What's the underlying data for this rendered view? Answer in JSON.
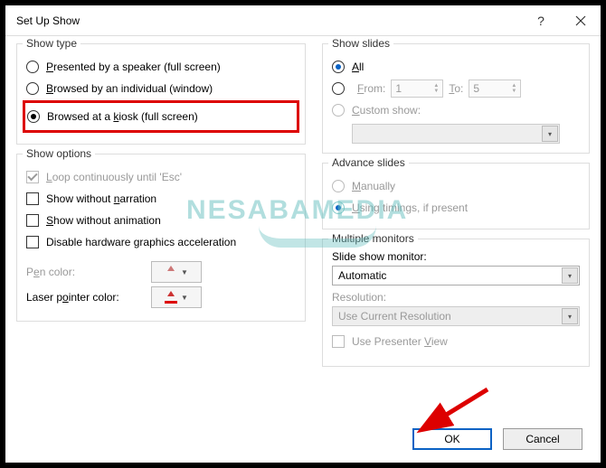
{
  "title": "Set Up Show",
  "groups": {
    "show_type": {
      "title": "Show type",
      "options": {
        "presented": "Presented by a speaker (full screen)",
        "browsed_individual": "Browsed by an individual (window)",
        "browsed_kiosk": "Browsed at a kiosk (full screen)"
      },
      "selected": "browsed_kiosk"
    },
    "show_options": {
      "title": "Show options",
      "loop": "Loop continuously until 'Esc'",
      "no_narration": "Show without narration",
      "no_animation": "Show without animation",
      "disable_hw": "Disable hardware graphics acceleration",
      "pen_color_label": "Pen color:",
      "laser_color_label": "Laser pointer color:"
    },
    "show_slides": {
      "title": "Show slides",
      "all": "All",
      "from": "From:",
      "to": "To:",
      "from_value": "1",
      "to_value": "5",
      "custom": "Custom show:",
      "selected": "all"
    },
    "advance": {
      "title": "Advance slides",
      "manually": "Manually",
      "timings": "Using timings, if present",
      "selected": "timings"
    },
    "monitors": {
      "title": "Multiple monitors",
      "monitor_label": "Slide show monitor:",
      "monitor_value": "Automatic",
      "resolution_label": "Resolution:",
      "resolution_value": "Use Current Resolution",
      "presenter_view": "Use Presenter View"
    }
  },
  "buttons": {
    "ok": "OK",
    "cancel": "Cancel"
  },
  "watermark": "NESABAMEDIA"
}
